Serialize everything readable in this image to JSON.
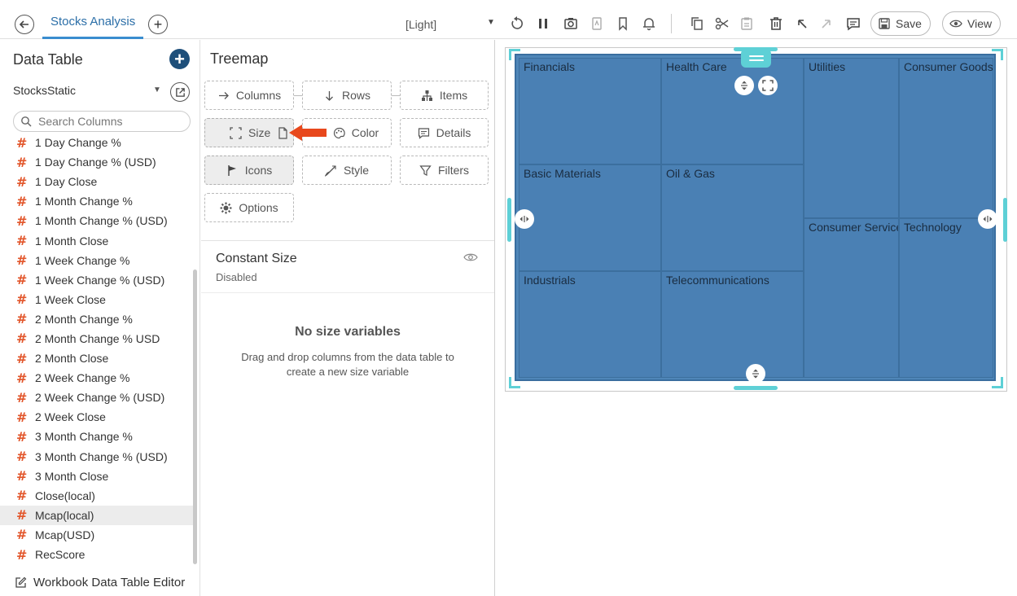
{
  "header": {
    "tab_title": "Stocks Analysis",
    "theme": "[Light]",
    "save_label": "Save",
    "view_label": "View"
  },
  "data_table": {
    "title": "Data Table",
    "source": "StocksStatic",
    "search_placeholder": "Search Columns",
    "columns": [
      "1 Day Change %",
      "1 Day Change % (USD)",
      "1 Day Close",
      "1 Month Change %",
      "1 Month Change % (USD)",
      "1 Month Close",
      "1 Week Change %",
      "1 Week Change % (USD)",
      "1 Week Close",
      "2 Month Change %",
      "2 Month Change % USD",
      "2 Month Close",
      "2 Week Change %",
      "2 Week Change % (USD)",
      "2 Week Close",
      "3 Month Change %",
      "3 Month Change % (USD)",
      "3 Month Close",
      "Close(local)",
      "Mcap(local)",
      "Mcap(USD)",
      "RecScore"
    ],
    "selected_column": "Mcap(local)",
    "editor_link": "Workbook Data Table Editor"
  },
  "visual": {
    "title": "Treemap",
    "buttons": {
      "columns": "Columns",
      "rows": "Rows",
      "items": "Items",
      "size": "Size",
      "color": "Color",
      "details": "Details",
      "icons": "Icons",
      "style": "Style",
      "filters": "Filters",
      "options": "Options"
    },
    "size_panel": {
      "title": "Constant Size",
      "status": "Disabled",
      "empty_title": "No size variables",
      "empty_desc": "Drag and drop columns from the data table to create a new size variable"
    }
  },
  "treemap": {
    "cells": [
      "Financials",
      "Health Care",
      "Utilities",
      "Consumer Goods",
      "Basic Materials",
      "Oil & Gas",
      "Consumer Services",
      "Technology",
      "Industrials",
      "Telecommunications"
    ]
  },
  "colors": {
    "accent": "#3a8dcf",
    "add_button": "#1e4f7a",
    "column_hash": "#e2562b",
    "callout_arrow": "#e8481c",
    "treemap_fill": "#4a80b4",
    "selection_handles": "#5ed0d6"
  }
}
